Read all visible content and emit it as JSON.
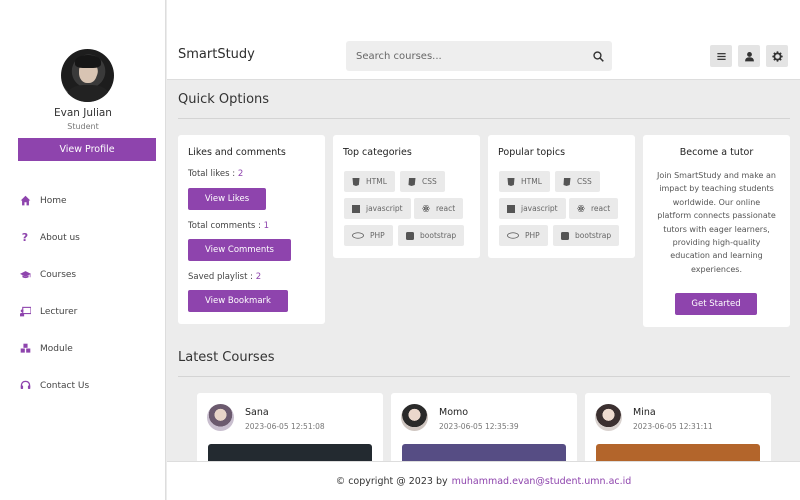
{
  "sidebar": {
    "user_name": "Evan Julian",
    "user_role": "Student",
    "profile_button": "View Profile",
    "items": [
      {
        "label": "Home",
        "icon": "home-icon"
      },
      {
        "label": "About us",
        "icon": "question-icon"
      },
      {
        "label": "Courses",
        "icon": "graduation-cap-icon"
      },
      {
        "label": "Lecturer",
        "icon": "chalkboard-teacher-icon"
      },
      {
        "label": "Module",
        "icon": "cubes-icon"
      },
      {
        "label": "Contact Us",
        "icon": "headset-icon"
      }
    ]
  },
  "header": {
    "brand": "SmartStudy",
    "search_placeholder": "Search courses...",
    "buttons": [
      "menu-icon",
      "user-icon",
      "gear-icon"
    ]
  },
  "quick_options": {
    "title": "Quick Options",
    "likes_card": {
      "title": "Likes and comments",
      "total_likes_label": "Total likes : ",
      "total_likes": "2",
      "view_likes": "View Likes",
      "total_comments_label": "Total comments : ",
      "total_comments": "1",
      "view_comments": "View Comments",
      "saved_playlist_label": "Saved playlist : ",
      "saved_playlist": "2",
      "view_bookmark": "View Bookmark"
    },
    "top_categories": {
      "title": "Top categories",
      "tags": [
        "HTML",
        "CSS",
        "javascript",
        "react",
        "PHP",
        "bootstrap"
      ]
    },
    "popular_topics": {
      "title": "Popular topics",
      "tags": [
        "HTML",
        "CSS",
        "javascript",
        "react",
        "PHP",
        "bootstrap"
      ]
    },
    "tutor_card": {
      "title": "Become a tutor",
      "text": "Join SmartStudy and make an impact by teaching students worldwide. Our online platform connects passionate tutors with eager learners, providing high-quality education and learning experiences.",
      "button": "Get Started"
    }
  },
  "latest_courses": {
    "title": "Latest Courses",
    "items": [
      {
        "name": "Sana",
        "date": "2023-06-05 12:51:08",
        "thumb_color": "#232a30"
      },
      {
        "name": "Momo",
        "date": "2023-06-05 12:35:39",
        "thumb_color": "#564d84"
      },
      {
        "name": "Mina",
        "date": "2023-06-05 12:31:11",
        "thumb_color": "#b3652b"
      }
    ]
  },
  "footer": {
    "text": "© copyright @ 2023 by",
    "email": "muhammad.evan@student.umn.ac.id"
  },
  "colors": {
    "accent": "#8e44ad",
    "background": "#ececec"
  }
}
